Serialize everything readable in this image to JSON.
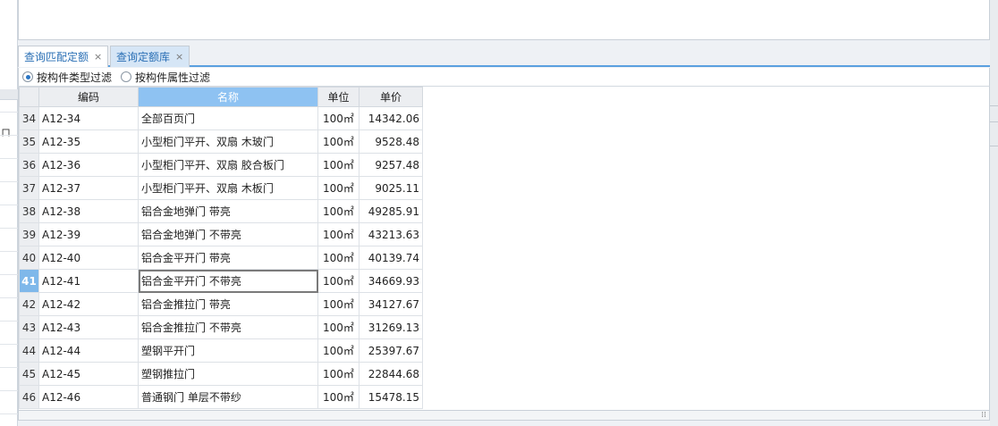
{
  "tabs": [
    {
      "label": "查询匹配定额",
      "close": "×"
    },
    {
      "label": "查询定额库",
      "close": "×"
    }
  ],
  "filter": {
    "options": [
      {
        "label": "按构件类型过滤",
        "checked": true
      },
      {
        "label": "按构件属性过滤",
        "checked": false
      }
    ]
  },
  "left_strip": {
    "cut_text": "ロ"
  },
  "table": {
    "columns": [
      "",
      "编码",
      "名称",
      "单位",
      "单价"
    ],
    "rows": [
      {
        "n": "34",
        "code": "A12-34",
        "name": "全部百页门",
        "unit": "100㎡",
        "price": "14342.06"
      },
      {
        "n": "35",
        "code": "A12-35",
        "name": "小型柜门平开、双扇 木玻门",
        "unit": "100㎡",
        "price": "9528.48"
      },
      {
        "n": "36",
        "code": "A12-36",
        "name": "小型柜门平开、双扇 胶合板门",
        "unit": "100㎡",
        "price": "9257.48"
      },
      {
        "n": "37",
        "code": "A12-37",
        "name": "小型柜门平开、双扇 木板门",
        "unit": "100㎡",
        "price": "9025.11"
      },
      {
        "n": "38",
        "code": "A12-38",
        "name": "铝合金地弹门 带亮",
        "unit": "100㎡",
        "price": "49285.91"
      },
      {
        "n": "39",
        "code": "A12-39",
        "name": "铝合金地弹门 不带亮",
        "unit": "100㎡",
        "price": "43213.63"
      },
      {
        "n": "40",
        "code": "A12-40",
        "name": "铝合金平开门 带亮",
        "unit": "100㎡",
        "price": "40139.74"
      },
      {
        "n": "41",
        "code": "A12-41",
        "name": "铝合金平开门 不带亮",
        "unit": "100㎡",
        "price": "34669.93"
      },
      {
        "n": "42",
        "code": "A12-42",
        "name": "铝合金推拉门 带亮",
        "unit": "100㎡",
        "price": "34127.67"
      },
      {
        "n": "43",
        "code": "A12-43",
        "name": "铝合金推拉门 不带亮",
        "unit": "100㎡",
        "price": "31269.13"
      },
      {
        "n": "44",
        "code": "A12-44",
        "name": "塑钢平开门",
        "unit": "100㎡",
        "price": "25397.67"
      },
      {
        "n": "45",
        "code": "A12-45",
        "name": "塑钢推拉门",
        "unit": "100㎡",
        "price": "22844.68"
      },
      {
        "n": "46",
        "code": "A12-46",
        "name": "普通钢门 单层不带纱",
        "unit": "100㎡",
        "price": "15478.15"
      }
    ],
    "selected_row": 7
  },
  "resize_grip": "⁞⁞"
}
